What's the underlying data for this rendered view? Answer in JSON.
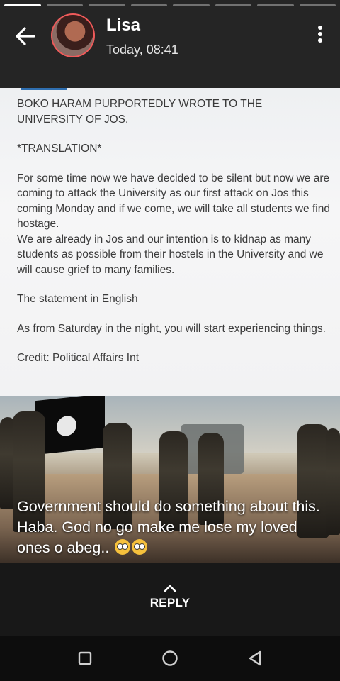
{
  "story": {
    "progress": {
      "total": 8,
      "active_index": 0
    },
    "user_name": "Lisa",
    "timestamp": "Today, 08:41"
  },
  "document": {
    "title": "BOKO HARAM PURPORTEDLY WROTE TO THE UNIVERSITY OF JOS.",
    "subtitle": "*TRANSLATION*",
    "paragraph1": "For some time now we have decided to be silent but now we are coming to attack the University as our first attack on Jos this coming Monday and if we come, we will take all students we find hostage.",
    "paragraph2": "We are already in Jos and our intention is to kidnap as many students as possible from their hostels in the University and we will cause grief to many families.",
    "line3": "The statement in English",
    "line4": "As from  Saturday in the night, you will start experiencing things.",
    "credit": "Credit: Political Affairs Int"
  },
  "caption": {
    "text": "Government should do something about this. Haba. God no go make me lose my loved ones o abeg..",
    "emoji": "flushed-face-emoji x2"
  },
  "reply": {
    "label": "REPLY"
  },
  "colors": {
    "header_bg": "#252525",
    "avatar_ring": "#f05a5a",
    "doc_accent": "#2f6fb0"
  }
}
